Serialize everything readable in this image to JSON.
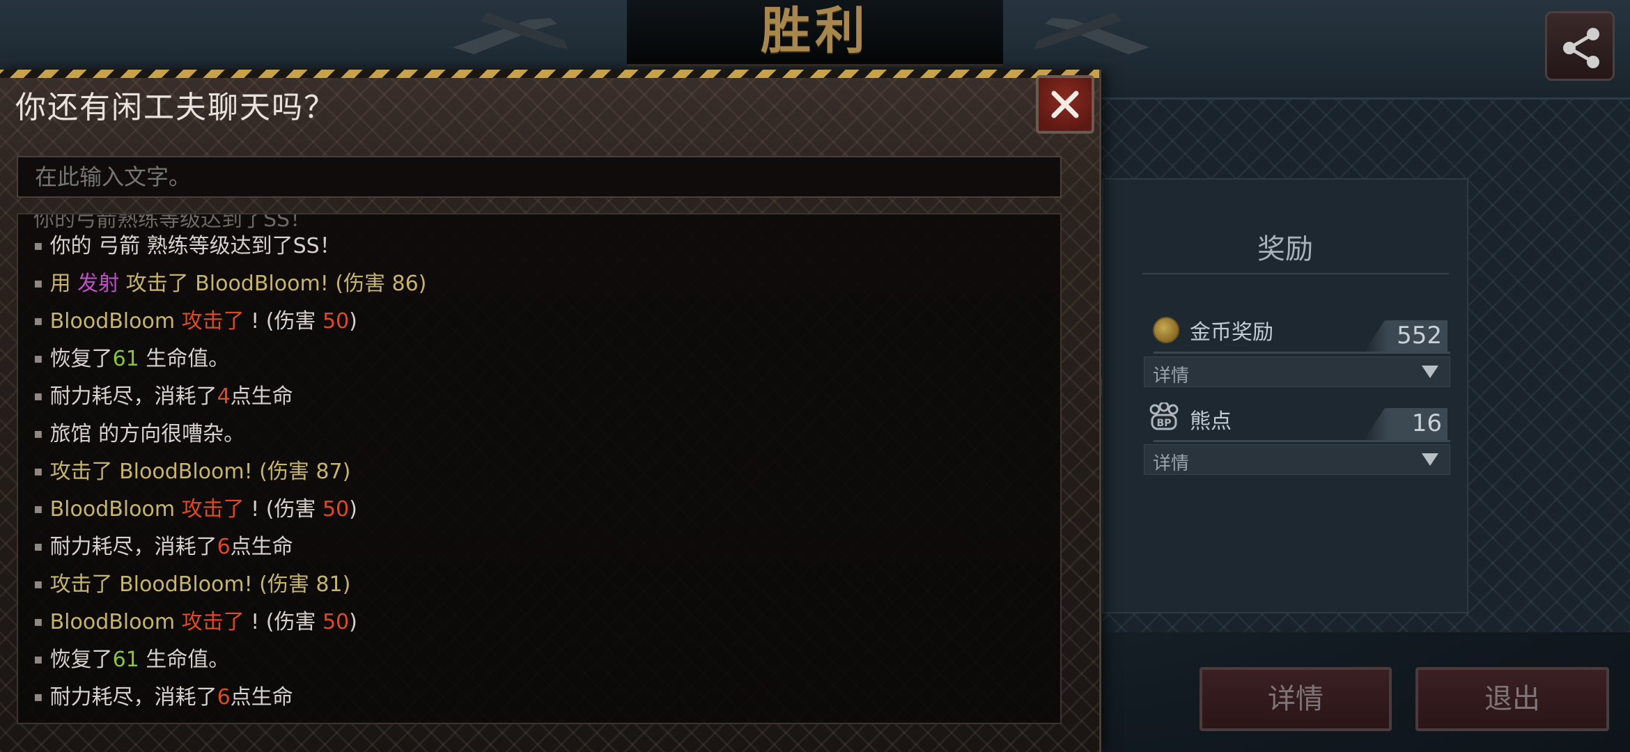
{
  "victory_title": "胜利",
  "chat": {
    "title": "你还有闲工夫聊天吗？",
    "input_placeholder": "在此输入文字。",
    "cut_text": "你的弓箭熟练等级达到了SS！",
    "lines": [
      [
        {
          "t": "你的 弓箭 熟练等级达到了SS！",
          "c": "white"
        }
      ],
      [
        {
          "t": "用 ",
          "c": "gold"
        },
        {
          "t": "发射",
          "c": "purple"
        },
        {
          "t": " 攻击了  BloodBloom! (伤害 86)",
          "c": "gold"
        }
      ],
      [
        {
          "t": "BloodBloom  ",
          "c": "gold"
        },
        {
          "t": "攻击了",
          "c": "red"
        },
        {
          "t": " ! (伤害 ",
          "c": "white"
        },
        {
          "t": "50",
          "c": "red"
        },
        {
          "t": ")",
          "c": "white"
        }
      ],
      [
        {
          "t": "恢复了",
          "c": "white"
        },
        {
          "t": "61",
          "c": "green"
        },
        {
          "t": " 生命值。",
          "c": "white"
        }
      ],
      [
        {
          "t": "耐力耗尽，消耗了",
          "c": "white"
        },
        {
          "t": "4",
          "c": "red"
        },
        {
          "t": "点生命",
          "c": "white"
        }
      ],
      [
        {
          "t": "旅馆 的方向很嘈杂。",
          "c": "white"
        }
      ],
      [
        {
          "t": "攻击了 BloodBloom! (伤害 87)",
          "c": "gold"
        }
      ],
      [
        {
          "t": "BloodBloom  ",
          "c": "gold"
        },
        {
          "t": "攻击了",
          "c": "red"
        },
        {
          "t": " ! (伤害 ",
          "c": "white"
        },
        {
          "t": "50",
          "c": "red"
        },
        {
          "t": ")",
          "c": "white"
        }
      ],
      [
        {
          "t": "耐力耗尽，消耗了",
          "c": "white"
        },
        {
          "t": "6",
          "c": "red"
        },
        {
          "t": "点生命",
          "c": "white"
        }
      ],
      [
        {
          "t": "攻击了 BloodBloom! (伤害 81)",
          "c": "gold"
        }
      ],
      [
        {
          "t": "BloodBloom  ",
          "c": "gold"
        },
        {
          "t": "攻击了",
          "c": "red"
        },
        {
          "t": " ! (伤害 ",
          "c": "white"
        },
        {
          "t": "50",
          "c": "red"
        },
        {
          "t": ")",
          "c": "white"
        }
      ],
      [
        {
          "t": "恢复了",
          "c": "white"
        },
        {
          "t": "61",
          "c": "green"
        },
        {
          "t": " 生命值。",
          "c": "white"
        }
      ],
      [
        {
          "t": "耐力耗尽，消耗了",
          "c": "white"
        },
        {
          "t": "6",
          "c": "red"
        },
        {
          "t": "点生命",
          "c": "white"
        }
      ]
    ]
  },
  "rewards": {
    "title": "奖励",
    "gold_label": "金币奖励",
    "gold_value": "552",
    "bear_label": "熊点",
    "bear_value": "16",
    "detail_label": "详情"
  },
  "buttons": {
    "details": "详情",
    "exit": "退出"
  },
  "colors": {
    "gold_text": "#c8b56c",
    "purple_text": "#c050c8",
    "red_text": "#e04a22",
    "green_text": "#8cc43a",
    "victory": "#a8874e"
  }
}
